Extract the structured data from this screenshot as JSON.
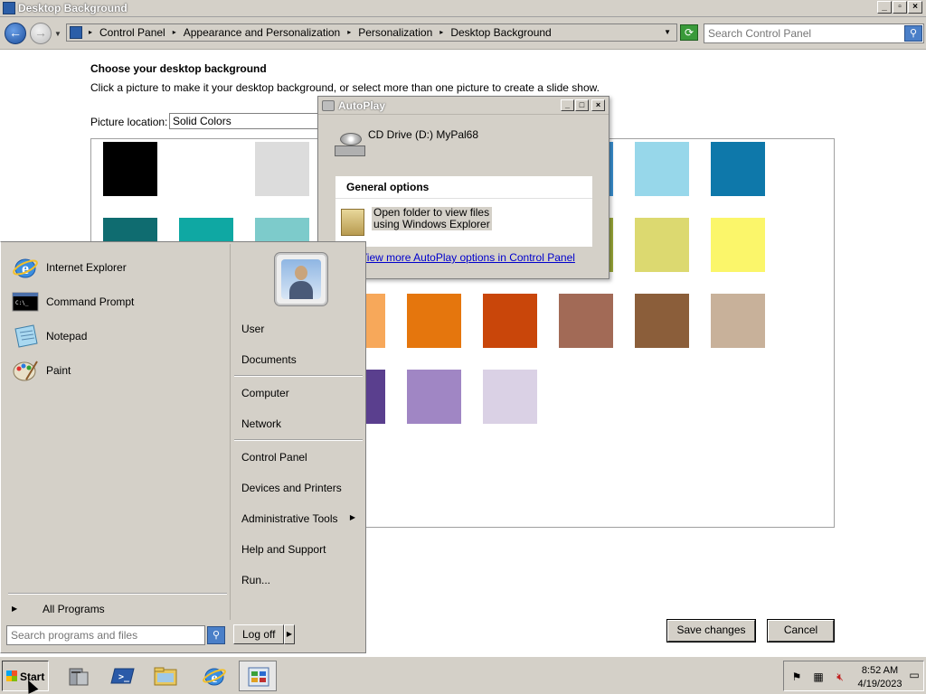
{
  "window": {
    "title": "Desktop Background"
  },
  "address": {
    "crumbs": [
      "Control Panel",
      "Appearance and Personalization",
      "Personalization",
      "Desktop Background"
    ],
    "search_placeholder": "Search Control Panel"
  },
  "main": {
    "heading": "Choose your desktop background",
    "subtext": "Click a picture to make it your desktop background, or select more than one picture to create a slide show.",
    "location_label": "Picture location:",
    "location_value": "Solid Colors",
    "swatches": [
      "#000000",
      "#ffffff",
      "#dcdcdc",
      "#3a8fd0",
      "#97d7ea",
      "#0e78aa",
      "#0f6c70",
      "#0fa8a3",
      "#7dcbcb",
      "#9aa83a",
      "#dcd970",
      "#fbf66a",
      "#f7a85a",
      "#e5760d",
      "#c9460a",
      "#a26a56",
      "#8b5e3a",
      "#c8b19a",
      "#5a3f8e",
      "#a086c4",
      "#dad1e5"
    ],
    "save_label": "Save changes",
    "cancel_label": "Cancel"
  },
  "autoplay": {
    "title": "AutoPlay",
    "drive": "CD Drive (D:) MyPal68",
    "group_header": "General options",
    "option_line1": "Open folder to view files",
    "option_line2": "using Windows Explorer",
    "link": "View more AutoPlay options in Control Panel"
  },
  "startmenu": {
    "left_items": [
      {
        "label": "Internet Explorer",
        "icon": "internet-explorer-icon"
      },
      {
        "label": "Command Prompt",
        "icon": "command-prompt-icon"
      },
      {
        "label": "Notepad",
        "icon": "notepad-icon"
      },
      {
        "label": "Paint",
        "icon": "paint-icon"
      }
    ],
    "all_programs": "All Programs",
    "search_placeholder": "Search programs and files",
    "right_items": {
      "user": "User",
      "documents": "Documents",
      "computer": "Computer",
      "network": "Network",
      "control_panel": "Control Panel",
      "devices": "Devices and Printers",
      "admin_tools": "Administrative Tools",
      "help": "Help and Support",
      "run": "Run..."
    },
    "logoff": "Log off"
  },
  "taskbar": {
    "start_label": "Start",
    "time": "8:52 AM",
    "date": "4/19/2023"
  }
}
